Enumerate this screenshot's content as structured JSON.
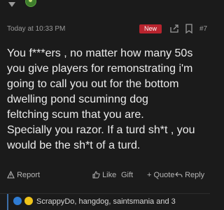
{
  "post": {
    "timestamp": "Today at 10:33 PM",
    "new_badge": "New",
    "post_number": "#7",
    "body_lines": [
      "You f***ers , no matter how many 50s",
      "you give players for remonstrating i'm",
      "going to call you out for the bottom",
      "dwelling pond scuminng dog",
      "feltching scum that you are.",
      "Specially you razor. If a turd sh*t , you",
      "would be the sh*t of a turd."
    ]
  },
  "actions": {
    "report": "Report",
    "like": "Like",
    "gift": "Gift",
    "quote": "+ Quote",
    "reply": "Reply"
  },
  "reactions": {
    "text": "ScrappyDo, hangdog, saintsmania and 3"
  },
  "colors": {
    "background": "#1b1b1b",
    "new_badge": "#b8242e",
    "reactions_accent": "#3d6fa8"
  }
}
